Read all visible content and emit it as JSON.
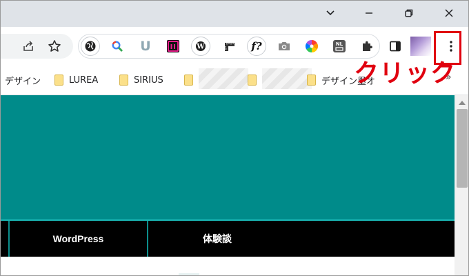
{
  "window": {
    "controls": [
      "chevron-down",
      "minimize",
      "restore",
      "close"
    ]
  },
  "toolbar": {
    "icons": [
      "share-icon",
      "bookmark-star-icon"
    ],
    "extensions": [
      "globe-icon",
      "search-color-icon",
      "u-icon",
      "tabs-icon",
      "wordpress-icon",
      "ruler-icon",
      "font-icon",
      "camera-icon",
      "color-wheel-icon",
      "nl-icon",
      "puzzle-icon"
    ],
    "extension_font_label": "f?",
    "extension_u_label": "U",
    "menu_icon": "kebab-menu-icon"
  },
  "bookmarks": {
    "items": [
      {
        "label": "デザイン"
      },
      {
        "label": "LUREA"
      },
      {
        "label": "SIRIUS"
      },
      {
        "label": "デザイン墨オ"
      }
    ],
    "overflow": "»"
  },
  "annotation": {
    "text": "クリック",
    "color": "#e0000f"
  },
  "page": {
    "hero_color": "#008b8a",
    "nav": [
      {
        "label": "WordPress"
      },
      {
        "label": "体験談"
      }
    ]
  }
}
